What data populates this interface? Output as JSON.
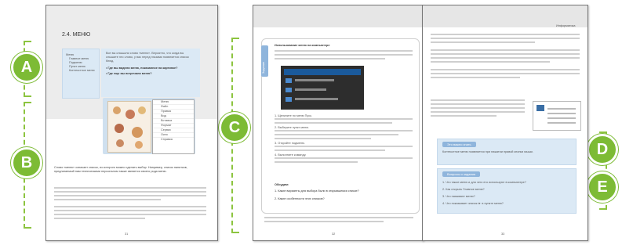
{
  "badges": {
    "a": "A",
    "b": "B",
    "c": "C",
    "d": "D",
    "e": "E"
  },
  "left_page": {
    "title": "2.4. МЕНЮ",
    "page_number": "31",
    "sidebar_items": [
      "Меню",
      "Главное меню",
      "Подменю",
      "Пункт меню",
      "Контекстное меню"
    ],
    "intro_text": "Все вы слышали слово «меню». Вероятно, что когда вы слышите это слово, у вас перед глазами появляется список блюд.",
    "questions": [
      "Где вы видели меню, показанное на картинке?",
      "Где еще вы встречали меню?"
    ],
    "menu_items": [
      "Меню",
      "Файл",
      "Правка",
      "Вид",
      "Вставка",
      "Формат",
      "Сервис",
      "Окно",
      "Справка"
    ],
    "paragraph": "Слово «меню» означает список, из которого можно сделать выбор. Например, список напитков, предлагаемый нам техническими персоналом также является своего рода меню."
  },
  "middle_page": {
    "header_title": "Использование меню на компьютере",
    "side_tab": "Задание",
    "page_number": "32",
    "steps_title": "Обсудим:",
    "steps": [
      "Щелкните по меню Пуск.",
      "Выберите пункт меню.",
      "Откройте подменю.",
      "Выполните команду."
    ],
    "discuss": [
      "Какие варианты для выбора были в открывшемся списке?",
      "Какие особенности этих списков?"
    ]
  },
  "right_page": {
    "header_right": "Информатика",
    "page_number": "33",
    "box_d_title": "Это важно знать",
    "box_d_text": "Контекстное меню появляется при нажатии правой кнопки мыши.",
    "box_e_title": "Вопросы и задания",
    "questions": [
      "Что такое меню и для чего его используют в компьютере?",
      "Как открыть Главное меню?",
      "Что называют меню?",
      "Что показывает значок ► в пункте меню?"
    ]
  },
  "colors": {
    "accent": "#7dbb35",
    "blue_box": "#dbe9f5",
    "header_gray": "#e6e6e6"
  }
}
